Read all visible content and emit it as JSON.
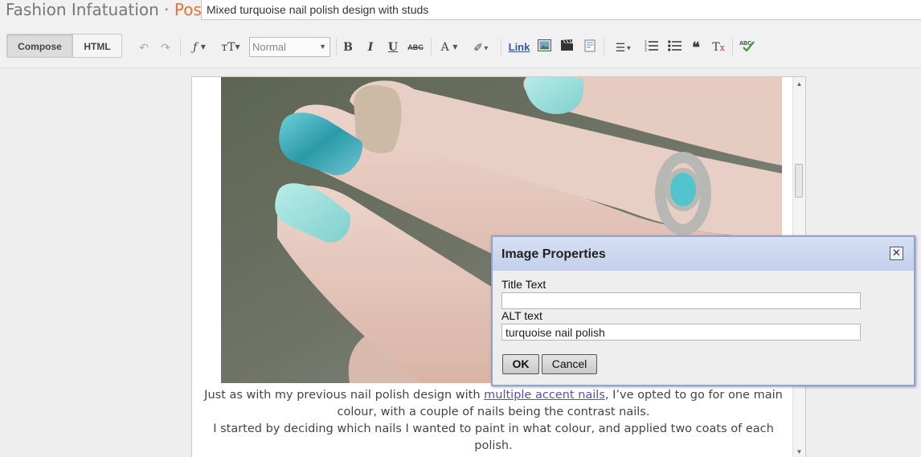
{
  "header": {
    "blog_title": "Fashion Infatuation",
    "separator": "·",
    "section": "Post",
    "post_title": "Mixed turquoise nail polish design with studs"
  },
  "toolbar": {
    "compose_label": "Compose",
    "html_label": "HTML",
    "format_value": "Normal",
    "link_label": "Link",
    "icons": [
      "undo-icon",
      "redo-icon",
      "font-family-icon",
      "font-size-icon",
      "bold-icon",
      "italic-icon",
      "underline-icon",
      "strikethrough-icon",
      "text-color-icon",
      "highlight-icon",
      "image-icon",
      "video-icon",
      "jump-break-icon",
      "align-icon",
      "numbered-list-icon",
      "bulleted-list-icon",
      "quote-icon",
      "remove-formatting-icon",
      "spellcheck-icon"
    ]
  },
  "editor": {
    "para1_before": "Just as with my previous nail polish design with ",
    "para1_link": "multiple accent nails",
    "para1_after": ", I’ve opted to go for one main colour, with a couple of nails being the contrast nails.",
    "para2": "I started by deciding which nails I wanted to paint in what colour, and applied two coats of each polish."
  },
  "dialog": {
    "title": "Image Properties",
    "title_text_label": "Title Text",
    "title_text_value": "",
    "alt_label": "ALT text",
    "alt_value": "turquoise nail polish",
    "ok_label": "OK",
    "cancel_label": "Cancel"
  },
  "colors": {
    "post_accent": "#e0733a",
    "link": "#5a4db0",
    "dialog_border": "#8fa4d6"
  }
}
